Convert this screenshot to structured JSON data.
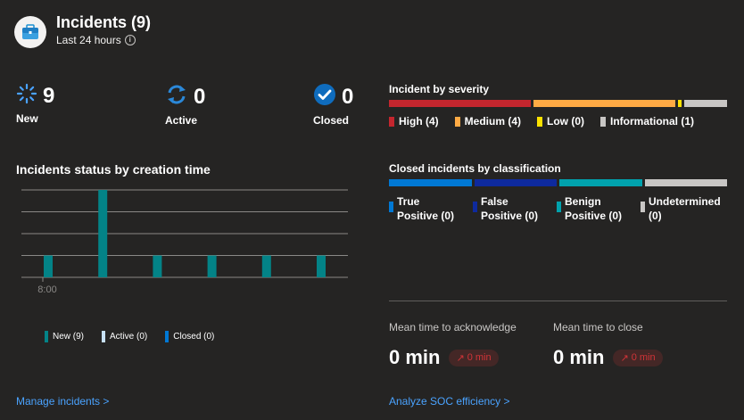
{
  "header": {
    "title": "Incidents (9)",
    "subtitle": "Last 24 hours"
  },
  "counters": {
    "new": {
      "value": "9",
      "label": "New"
    },
    "active": {
      "value": "0",
      "label": "Active"
    },
    "closed": {
      "value": "0",
      "label": "Closed"
    }
  },
  "status_chart": {
    "title": "Incidents status by creation time",
    "x_tick": "8:00",
    "legend": [
      "New (9)",
      "Active (0)",
      "Closed (0)"
    ],
    "colors": {
      "new": "#038387",
      "active": "#c7e0f4",
      "closed": "#0078d4"
    }
  },
  "chart_data": {
    "type": "bar",
    "title": "Incidents status by creation time",
    "categories": [
      "8:00",
      "",
      "",
      "",
      "",
      ""
    ],
    "series": [
      {
        "name": "New (9)",
        "values": [
          1,
          4,
          1,
          1,
          1,
          1
        ]
      },
      {
        "name": "Active (0)",
        "values": [
          0,
          0,
          0,
          0,
          0,
          0
        ]
      },
      {
        "name": "Closed (0)",
        "values": [
          0,
          0,
          0,
          0,
          0,
          0
        ]
      }
    ],
    "ylim": [
      0,
      4
    ],
    "grid": true
  },
  "severity": {
    "title": "Incident by severity",
    "items": [
      {
        "label": "High (4)",
        "color": "#c4262e",
        "value": 4
      },
      {
        "label": "Medium (4)",
        "color": "#ffaa44",
        "value": 4
      },
      {
        "label": "Low (0)",
        "color": "#fce100",
        "value": 0
      },
      {
        "label": "Informational (1)",
        "color": "#c8c6c4",
        "value": 1
      }
    ]
  },
  "classification": {
    "title": "Closed incidents by classification",
    "items": [
      {
        "line1": "True",
        "line2": "Positive (0)",
        "color": "#0078d4"
      },
      {
        "line1": "False",
        "line2": "Positive (0)",
        "color": "#0e2a9e"
      },
      {
        "line1": "Benign",
        "line2": "Positive (0)",
        "color": "#00a2ad"
      },
      {
        "line1": "Undetermined",
        "line2": "(0)",
        "color": "#c8c6c4"
      }
    ]
  },
  "metrics": {
    "ack": {
      "label": "Mean time to acknowledge",
      "value": "0 min",
      "delta": "0 min"
    },
    "close": {
      "label": "Mean time to close",
      "value": "0 min",
      "delta": "0 min"
    }
  },
  "links": {
    "manage": "Manage incidents >",
    "analyze": "Analyze SOC efficiency >"
  }
}
